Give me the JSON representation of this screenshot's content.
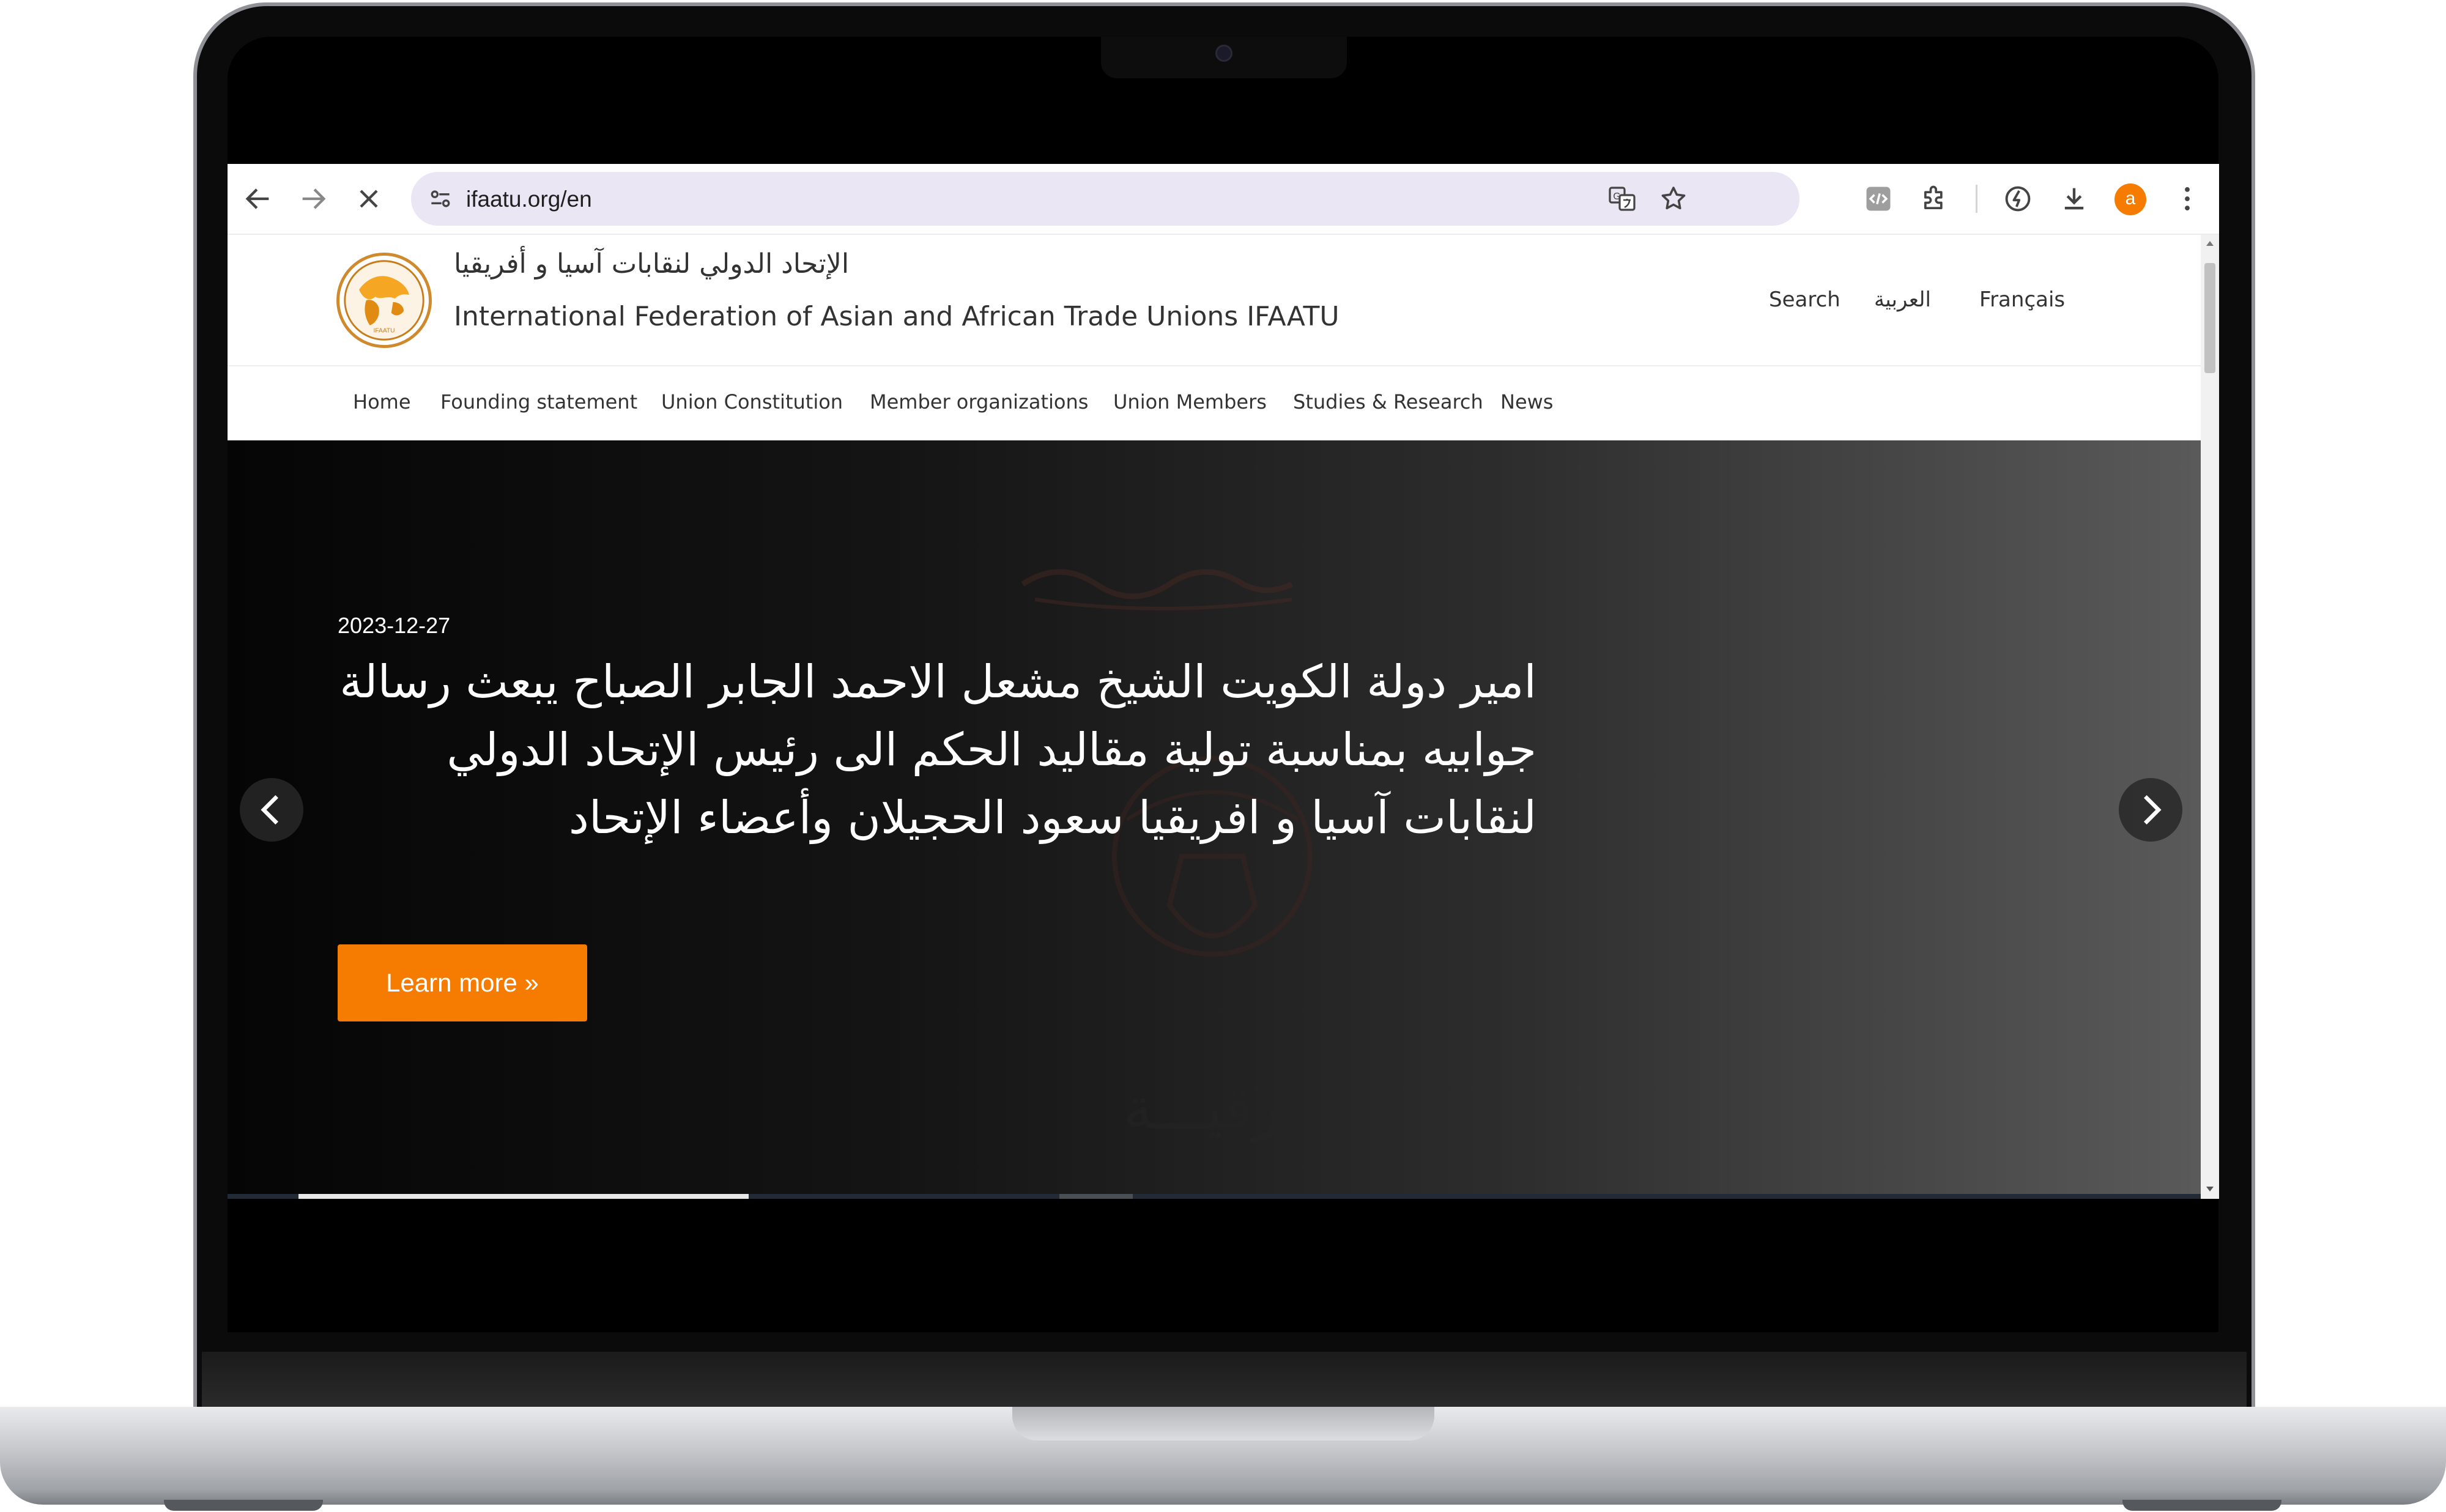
{
  "browser": {
    "url": "ifaatu.org/en",
    "profile_initial": "a"
  },
  "site": {
    "title_ar": "الإتحاد الدولي لنقابات آسيا و أفريقيا",
    "title_en": "International Federation of Asian and African Trade Unions IFAATU",
    "logo_text": "IFAATU"
  },
  "topnav": {
    "search": "Search",
    "arabic": "العربية",
    "french": "Français"
  },
  "mainnav": {
    "items": [
      "Home",
      "Founding statement",
      "Union Constitution",
      "Member organizations",
      "Union Members",
      "Studies & Research",
      "News"
    ]
  },
  "hero": {
    "date": "2023-12-27",
    "headline": "امير دولة الكويت الشيخ مشعل الاحمد الجابر الصباح يبعث رسالة جوابيه بمناسبة تولية مقاليد الحكم الى رئيس الإتحاد الدولي لنقابات آسيا و افريقيا سعود الحجيلان وأعضاء الإتحاد",
    "button": "Learn more »",
    "background_text": "برقيـــة"
  },
  "colors": {
    "accent": "#f57c00",
    "text": "#333333"
  }
}
